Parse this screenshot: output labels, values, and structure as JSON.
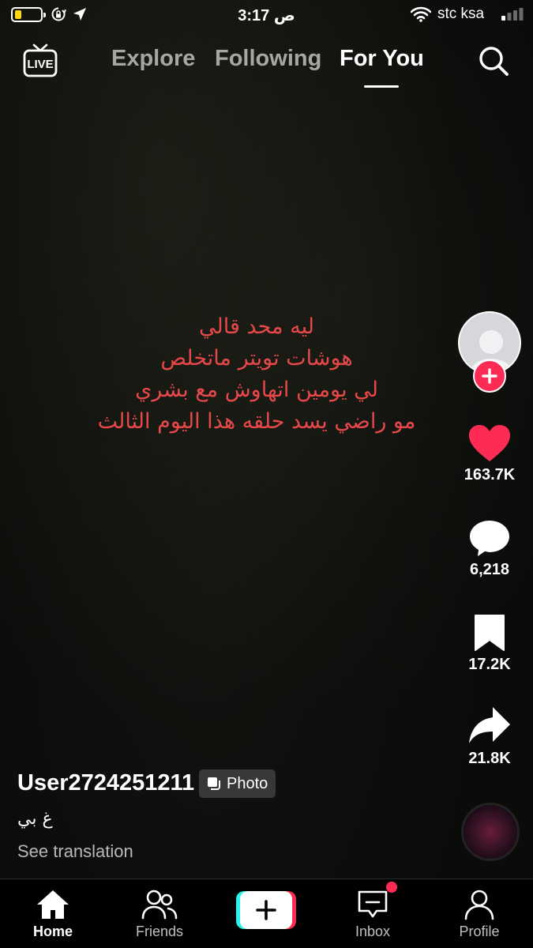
{
  "status_bar": {
    "time": "3:17 ص",
    "carrier": "stc ksa",
    "battery_color": "#ffd60a"
  },
  "top_nav": {
    "live_label": "LIVE",
    "tabs": [
      {
        "label": "Explore"
      },
      {
        "label": "Following"
      },
      {
        "label": "For You",
        "active": true
      }
    ]
  },
  "post": {
    "overlay_lines": [
      "ليه محد قالي",
      "هوشات تويتر ماتخلص",
      "لي يومين اتهاوش مع بشري",
      "مو راضي يسد حلقه هذا اليوم الثالث"
    ],
    "overlay_color": "#e8484a",
    "username": "User2724251211",
    "badge_label": "Photo",
    "caption": "غ بي",
    "see_translation": "See translation"
  },
  "actions": {
    "likes": "163.7K",
    "comments": "6,218",
    "saves": "17.2K",
    "shares": "21.8K",
    "like_color": "#fe2c55"
  },
  "bottom_nav": {
    "items": [
      {
        "label": "Home",
        "icon": "home-icon"
      },
      {
        "label": "Friends",
        "icon": "friends-icon"
      },
      {
        "label": "",
        "icon": "plus-icon"
      },
      {
        "label": "Inbox",
        "icon": "inbox-icon"
      },
      {
        "label": "Profile",
        "icon": "profile-icon"
      }
    ]
  }
}
